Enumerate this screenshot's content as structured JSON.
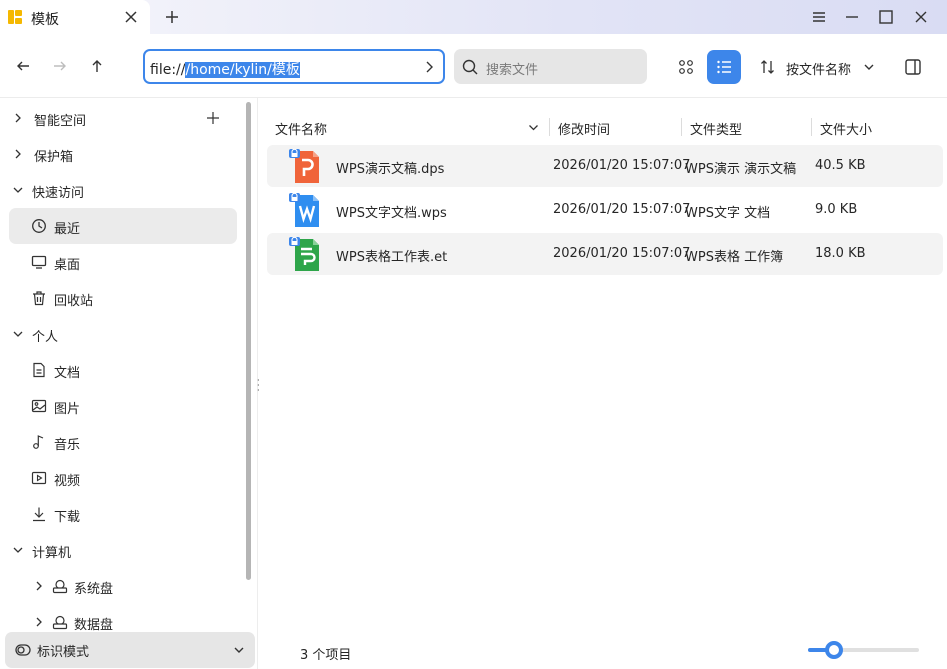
{
  "window": {
    "tab_title": "模板"
  },
  "toolbar": {
    "address_prefix": "file://",
    "address_selected": "/home/kylin/模板",
    "search_placeholder": "搜索文件",
    "sort_label": "按文件名称"
  },
  "sidebar": {
    "items": [
      {
        "label": "智能空间",
        "icon": "chevron-right-icon"
      },
      {
        "label": "保护箱",
        "icon": "chevron-right-icon"
      },
      {
        "label": "快速访问",
        "icon": "chevron-down-icon"
      },
      {
        "label": "最近",
        "icon": "clock-icon"
      },
      {
        "label": "桌面",
        "icon": "monitor-icon"
      },
      {
        "label": "回收站",
        "icon": "trash-icon"
      },
      {
        "label": "个人",
        "icon": "chevron-down-icon"
      },
      {
        "label": "文档",
        "icon": "document-icon"
      },
      {
        "label": "图片",
        "icon": "image-icon"
      },
      {
        "label": "音乐",
        "icon": "music-icon"
      },
      {
        "label": "视频",
        "icon": "video-icon"
      },
      {
        "label": "下载",
        "icon": "download-icon"
      },
      {
        "label": "计算机",
        "icon": "chevron-down-icon"
      },
      {
        "label": "系统盘",
        "icon": "drive-icon"
      },
      {
        "label": "数据盘",
        "icon": "drive-icon"
      }
    ],
    "bottom_label": "标识模式"
  },
  "main": {
    "columns": [
      "文件名称",
      "修改时间",
      "文件类型",
      "文件大小"
    ],
    "files": [
      {
        "name": "WPS演示文稿.dps",
        "modified": "2026/01/20 15:07:07",
        "type": "WPS演示 演示文稿",
        "size": "40.5 KB",
        "icon": "wps-presentation-icon",
        "color": "#f0643a"
      },
      {
        "name": "WPS文字文档.wps",
        "modified": "2026/01/20 15:07:07",
        "type": "WPS文字 文档",
        "size": "9.0 KB",
        "icon": "wps-writer-icon",
        "color": "#2f8ef0"
      },
      {
        "name": "WPS表格工作表.et",
        "modified": "2026/01/20 15:07:07",
        "type": "WPS表格 工作簿",
        "size": "18.0 KB",
        "icon": "wps-spreadsheet-icon",
        "color": "#2ea54a"
      }
    ],
    "item_count": "3 个项目",
    "zoom_level": 0.23
  },
  "colors": {
    "accent": "#3d86ea"
  }
}
